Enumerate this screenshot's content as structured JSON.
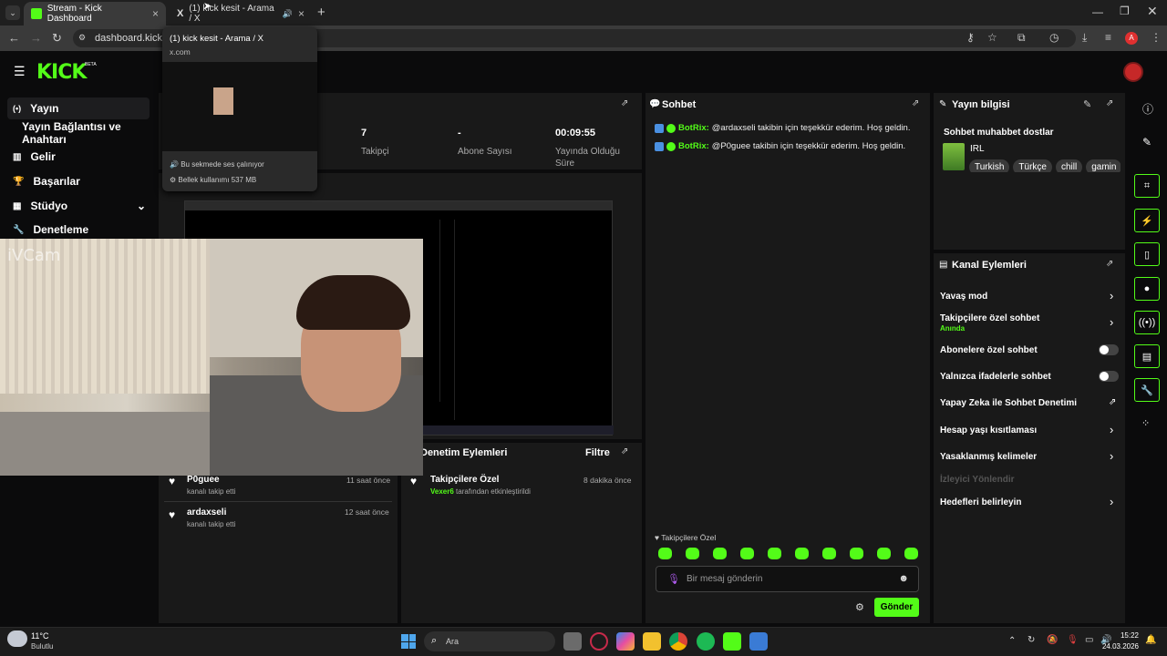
{
  "browser": {
    "tabs": [
      {
        "title": "Stream - Kick Dashboard",
        "active": true
      },
      {
        "title": "(1) kick kesit - Arama / X",
        "active": false
      }
    ],
    "url": "dashboard.kick.co",
    "tooltip": {
      "title": "(1) kick kesit - Arama / X",
      "domain": "x.com",
      "audio": "Bu sekmede ses çalınıyor",
      "memory": "Bellek kullanımı 537 MB"
    }
  },
  "sidebar": {
    "items": [
      {
        "label": "Yayın"
      },
      {
        "label": "Yayın Bağlantısı ve Anahtarı"
      },
      {
        "label": "Gelir"
      },
      {
        "label": "Başarılar"
      },
      {
        "label": "Stüdyo"
      },
      {
        "label": "Denetleme"
      }
    ]
  },
  "stats": {
    "followers_value": "7",
    "followers_label": "Takipçi",
    "subs_value": "-",
    "subs_label": "Abone Sayısı",
    "uptime_value": "00:09:55",
    "uptime_label1": "Yayında Olduğu",
    "uptime_label2": "Süre"
  },
  "webcam": {
    "label": "iVCam"
  },
  "followers_feed": [
    {
      "name": "P0guee",
      "action": "kanalı takip etti",
      "time": "11 saat önce"
    },
    {
      "name": "ardaxseli",
      "action": "kanalı takip etti",
      "time": "12 saat önce"
    }
  ],
  "mod_actions": {
    "title": "Denetim Eylemleri",
    "filter": "Filtre",
    "item": {
      "name": "Takipçilere Özel",
      "by": "Vexer6",
      "by_suffix": "tarafından etkinleştirildi",
      "time": "8 dakika önce"
    }
  },
  "chat": {
    "title": "Sohbet",
    "messages": [
      {
        "user": "BotRix:",
        "text": "@ardaxseli takibin için teşekkür ederim. Hoş geldin."
      },
      {
        "user": "BotRix:",
        "text": "@P0guee takibin için teşekkür ederim. Hoş geldin."
      }
    ],
    "followers_only": "Takipçilere Özel",
    "placeholder": "Bir mesaj gönderin",
    "send": "Gönder"
  },
  "stream_info": {
    "title": "Yayın bilgisi",
    "stream_title": "Sohbet muhabbet dostlar",
    "category": "IRL",
    "tags": [
      "Turkish",
      "Türkçe",
      "chill",
      "gamin"
    ]
  },
  "channel_actions": {
    "title": "Kanal Eylemleri",
    "items": [
      {
        "label": "Yavaş mod",
        "type": "chevron"
      },
      {
        "label": "Takipçilere özel sohbet",
        "sub": "Anında",
        "type": "chevron"
      },
      {
        "label": "Abonelere özel sohbet",
        "type": "toggle"
      },
      {
        "label": "Yalnızca ifadelerle sohbet",
        "type": "toggle"
      },
      {
        "label": "Yapay Zeka ile Sohbet Denetimi",
        "type": "external"
      },
      {
        "label": "Hesap yaşı kısıtlaması",
        "type": "chevron"
      },
      {
        "label": "Yasaklanmış kelimeler",
        "type": "chevron"
      },
      {
        "label": "İzleyici Yönlendir",
        "type": "disabled"
      },
      {
        "label": "Hedefleri belirleyin",
        "type": "chevron"
      }
    ]
  },
  "taskbar": {
    "weather_temp": "11°C",
    "weather_desc": "Bulutlu",
    "search": "Ara",
    "time": "15:22",
    "date": "24.03.2026"
  },
  "colors": {
    "accent": "#53fc18",
    "panel": "#191919",
    "bg": "#0b0b0c"
  }
}
